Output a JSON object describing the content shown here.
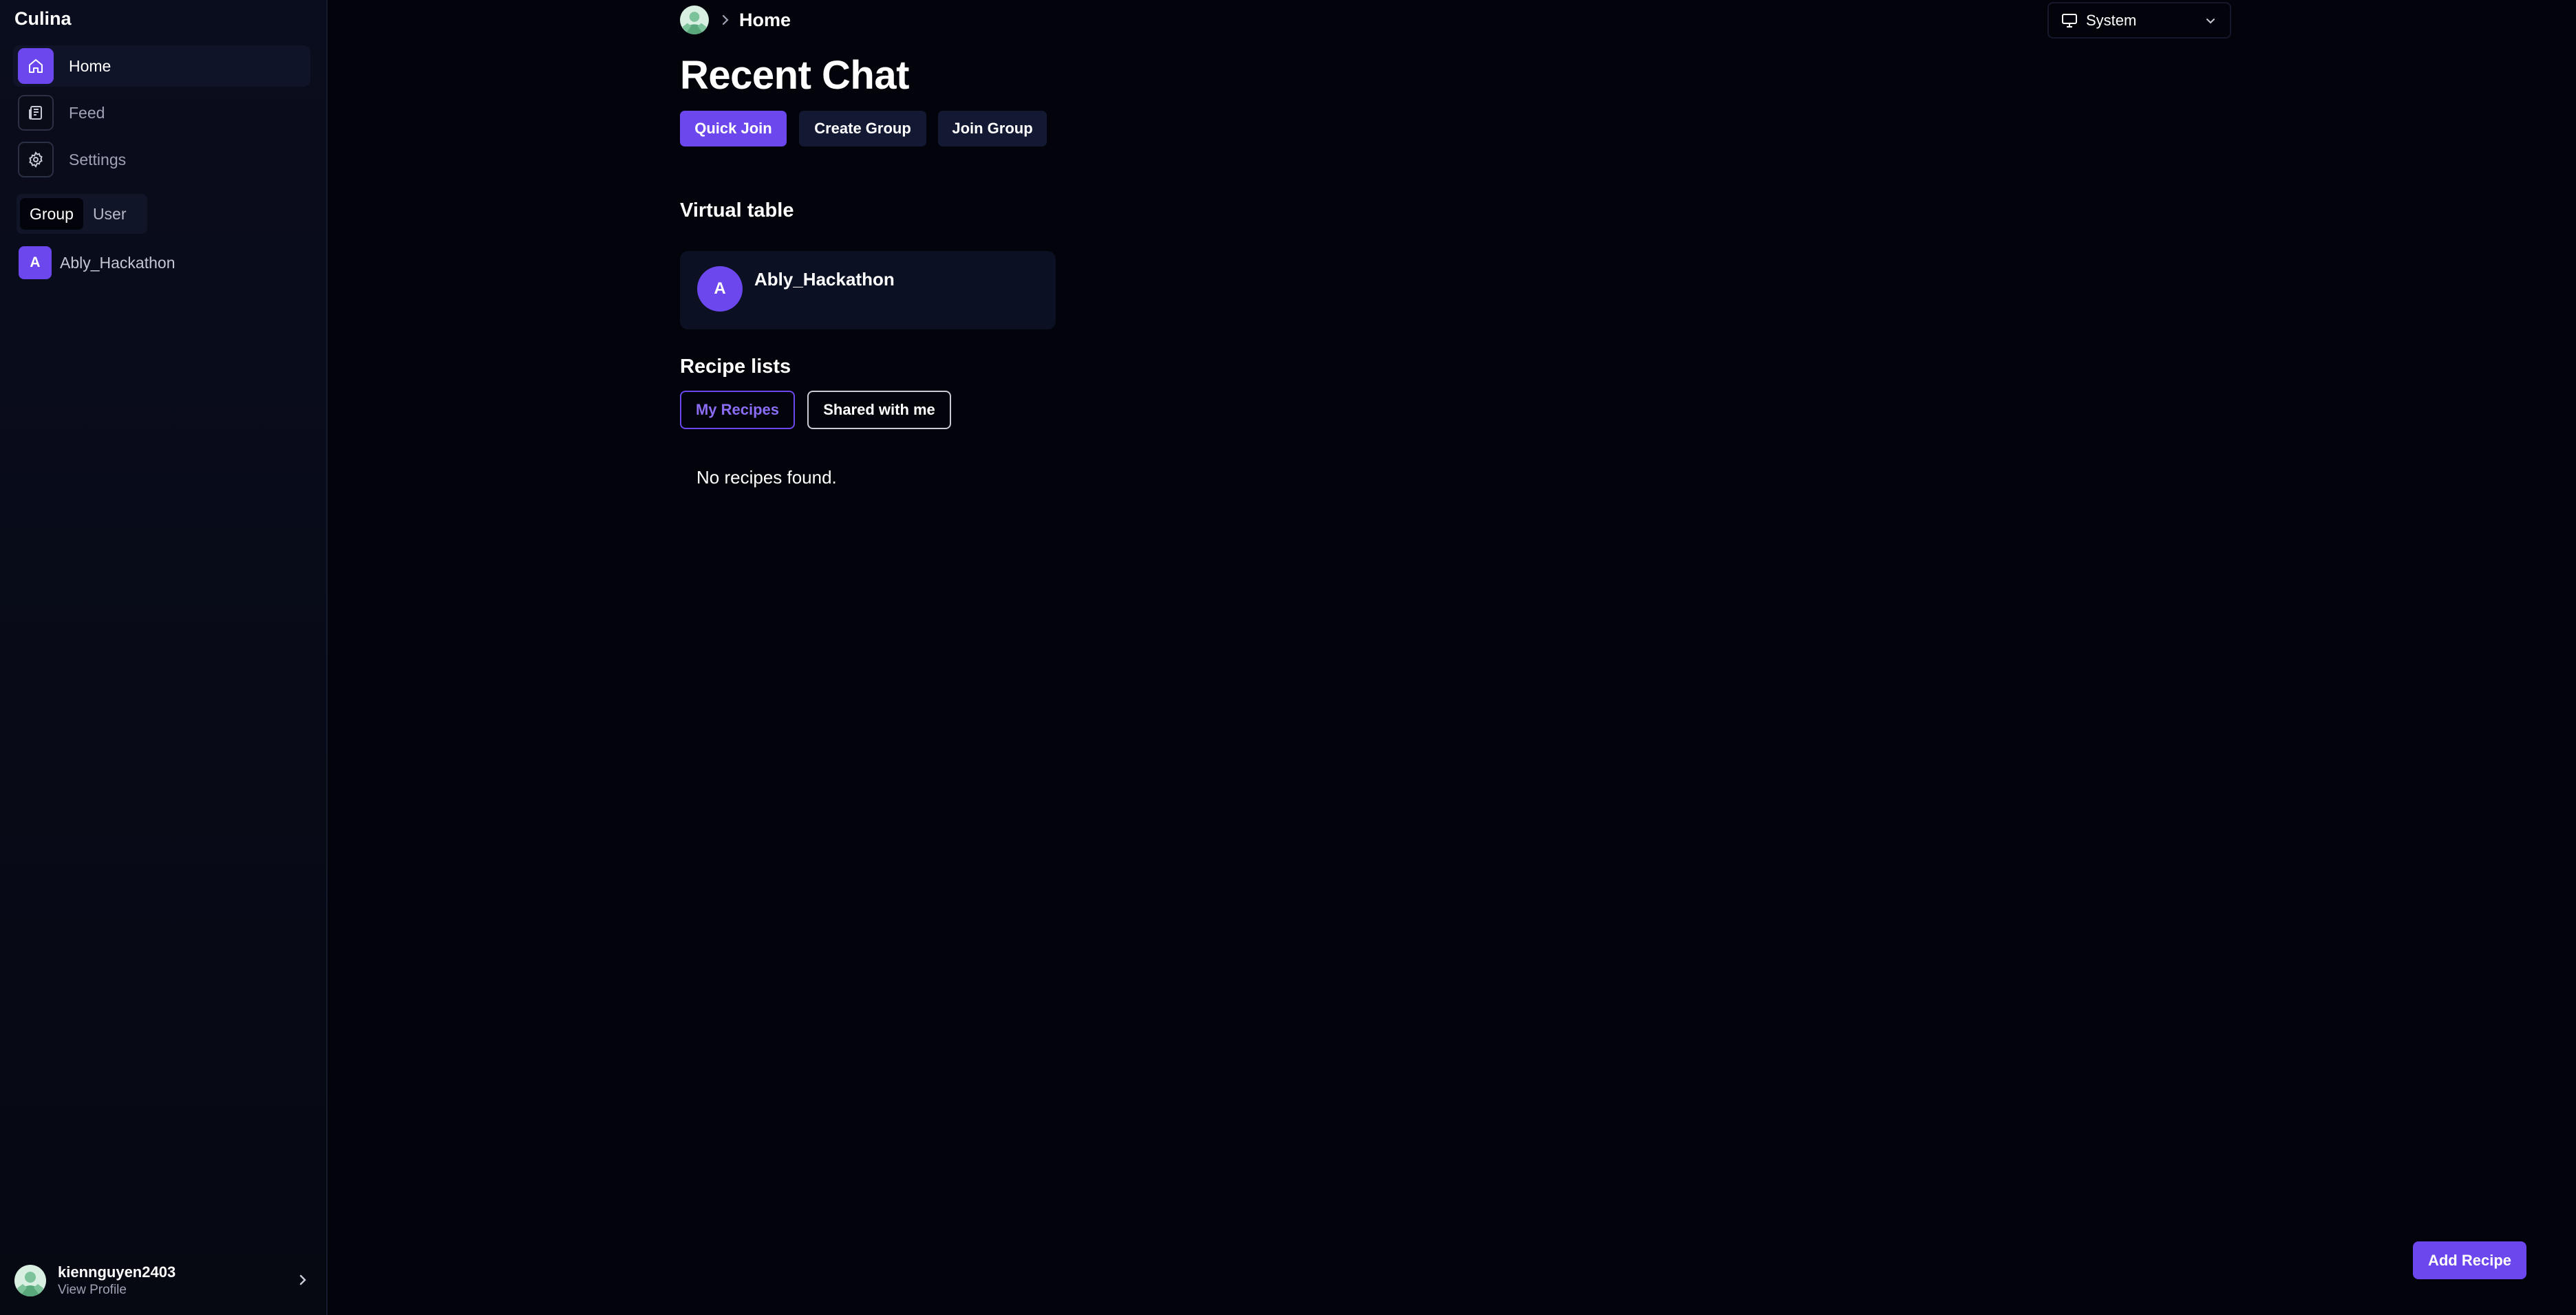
{
  "app": {
    "name": "Culina"
  },
  "sidebar": {
    "nav": [
      {
        "label": "Home",
        "icon": "home-icon",
        "active": true
      },
      {
        "label": "Feed",
        "icon": "newspaper-icon",
        "active": false
      },
      {
        "label": "Settings",
        "icon": "gear-icon",
        "active": false
      }
    ],
    "segments": [
      {
        "label": "Group",
        "active": true
      },
      {
        "label": "User",
        "active": false
      }
    ],
    "groups": [
      {
        "initial": "A",
        "name": "Ably_Hackathon"
      }
    ],
    "profile": {
      "username": "kiennguyen2403",
      "sub_label": "View Profile"
    }
  },
  "header": {
    "breadcrumb": "Home",
    "theme_select": {
      "value": "System",
      "icon": "monitor-icon"
    }
  },
  "main": {
    "title": "Recent Chat",
    "actions": {
      "quick_join": "Quick Join",
      "create_group": "Create Group",
      "join_group": "Join Group"
    },
    "virtual_table": {
      "heading": "Virtual table",
      "card": {
        "initial": "A",
        "name": "Ably_Hackathon"
      }
    },
    "recipes": {
      "heading": "Recipe lists",
      "tabs": {
        "mine": "My Recipes",
        "shared": "Shared with me"
      },
      "empty_text": "No recipes found."
    },
    "add_recipe": "Add Recipe"
  },
  "colors": {
    "accent": "#6c47ee",
    "background": "#03040b",
    "sidebar": "#0a0d1d",
    "card": "#0b1022"
  }
}
